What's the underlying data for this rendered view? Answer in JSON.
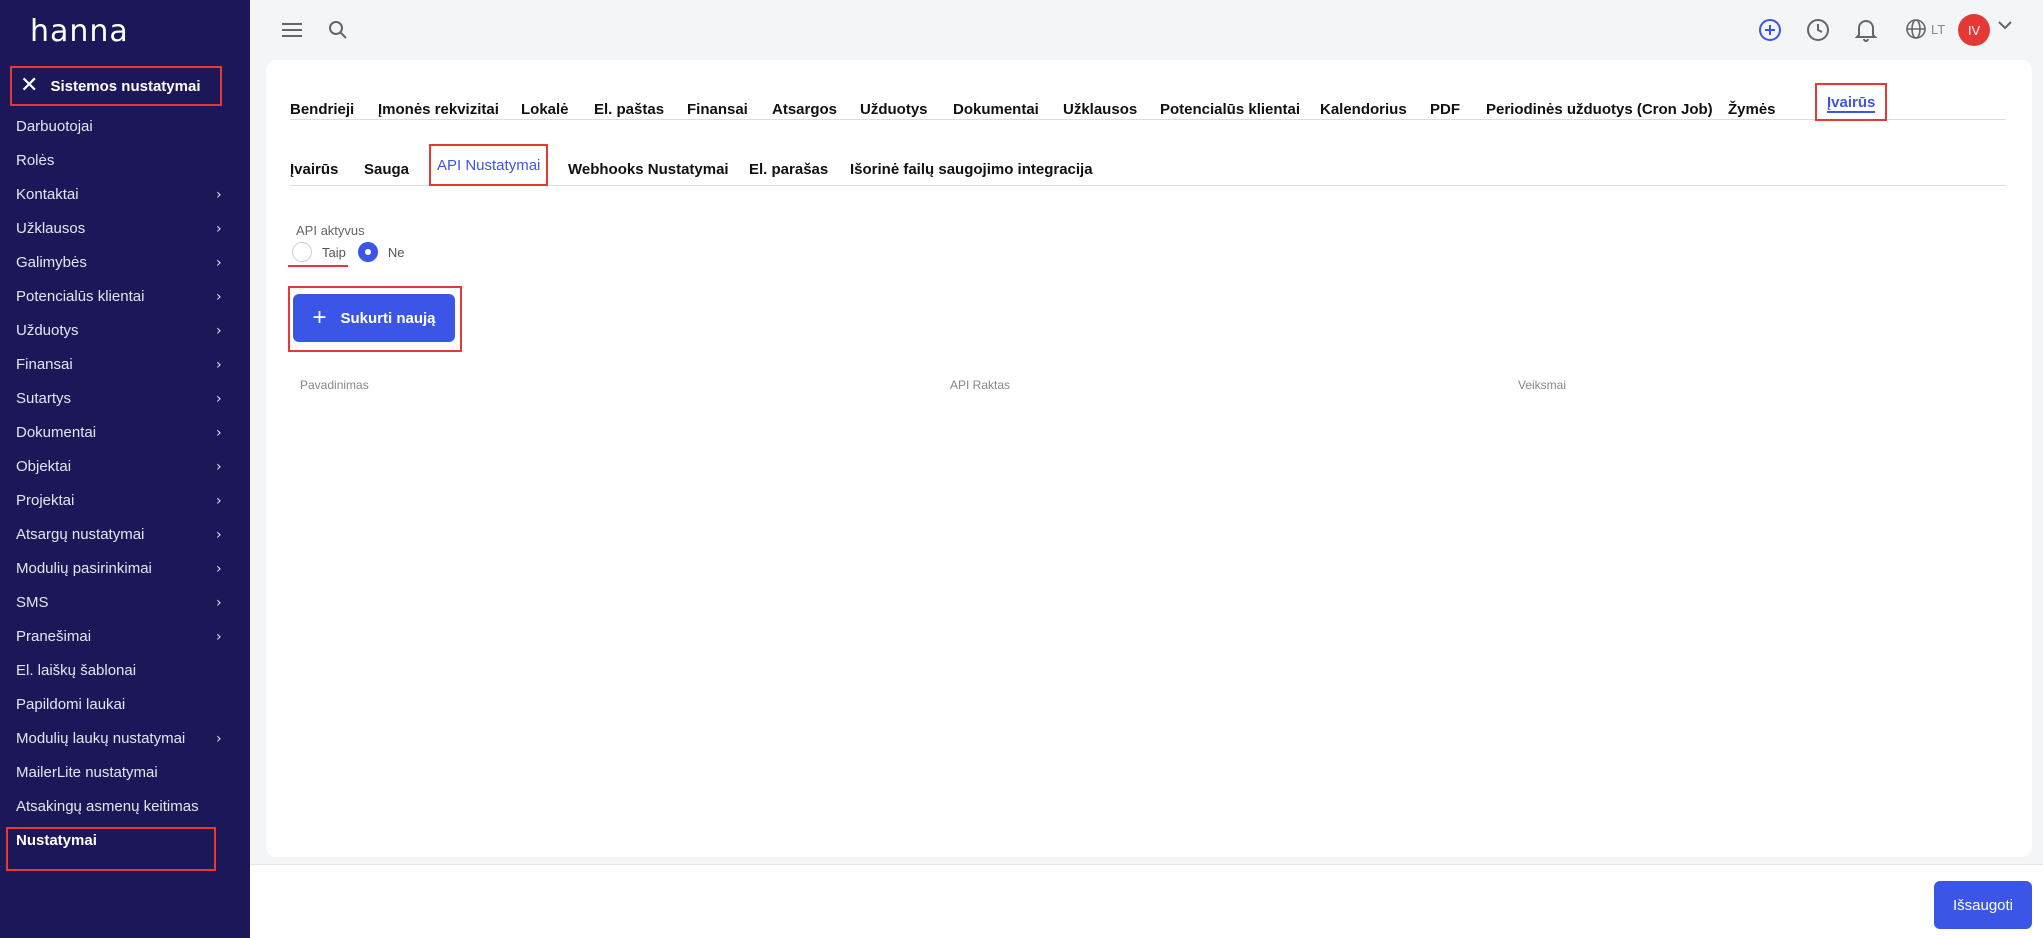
{
  "sidebar": {
    "logo": "hanna",
    "section_title": "Sistemos nustatymai",
    "items": [
      {
        "label": "Darbuotojai",
        "chevron": false
      },
      {
        "label": "Rolės",
        "chevron": false
      },
      {
        "label": "Kontaktai",
        "chevron": true
      },
      {
        "label": "Užklausos",
        "chevron": true
      },
      {
        "label": "Galimybės",
        "chevron": true
      },
      {
        "label": "Potencialūs klientai",
        "chevron": true
      },
      {
        "label": "Užduotys",
        "chevron": true
      },
      {
        "label": "Finansai",
        "chevron": true
      },
      {
        "label": "Sutartys",
        "chevron": true
      },
      {
        "label": "Dokumentai",
        "chevron": true
      },
      {
        "label": "Objektai",
        "chevron": true
      },
      {
        "label": "Projektai",
        "chevron": true
      },
      {
        "label": "Atsargų nustatymai",
        "chevron": true
      },
      {
        "label": "Modulių pasirinkimai",
        "chevron": true
      },
      {
        "label": "SMS",
        "chevron": true
      },
      {
        "label": "Pranešimai",
        "chevron": true
      },
      {
        "label": "El. laiškų šablonai",
        "chevron": false
      },
      {
        "label": "Papildomi laukai",
        "chevron": false
      },
      {
        "label": "Modulių laukų nustatymai",
        "chevron": true
      },
      {
        "label": "MailerLite nustatymai",
        "chevron": false
      },
      {
        "label": "Atsakingų asmenų keitimas",
        "chevron": false
      },
      {
        "label": "Nustatymai",
        "chevron": false,
        "active": true
      }
    ]
  },
  "topbar": {
    "lang": "LT",
    "avatar_initials": "IV"
  },
  "tabs_main": [
    {
      "label": "Bendrieji"
    },
    {
      "label": "Įmonės rekvizitai"
    },
    {
      "label": "Lokalė"
    },
    {
      "label": "El. paštas"
    },
    {
      "label": "Finansai"
    },
    {
      "label": "Atsargos"
    },
    {
      "label": "Užduotys"
    },
    {
      "label": "Dokumentai"
    },
    {
      "label": "Užklausos"
    },
    {
      "label": "Potencialūs klientai"
    },
    {
      "label": "Kalendorius"
    },
    {
      "label": "PDF"
    },
    {
      "label": "Periodinės užduotys (Cron Job)"
    },
    {
      "label": "Žymės"
    },
    {
      "label": "Įvairūs",
      "active": true
    }
  ],
  "tabs_sub": [
    {
      "label": "Įvairūs"
    },
    {
      "label": "Sauga"
    },
    {
      "label": "API Nustatymai",
      "active": true
    },
    {
      "label": "Webhooks Nustatymai"
    },
    {
      "label": "El. parašas"
    },
    {
      "label": "Išorinė failų saugojimo integracija"
    }
  ],
  "api": {
    "label": "API aktyvus",
    "option_yes": "Taip",
    "option_no": "Ne",
    "selected": "Ne",
    "create_label": "Sukurti naują"
  },
  "table": {
    "columns": [
      "Pavadinimas",
      "API Raktas",
      "Veiksmai"
    ]
  },
  "footer": {
    "save_label": "Išsaugoti"
  },
  "colors": {
    "sidebar_bg": "#1b1758",
    "accent": "#3b56e6",
    "highlight": "#e53935"
  }
}
